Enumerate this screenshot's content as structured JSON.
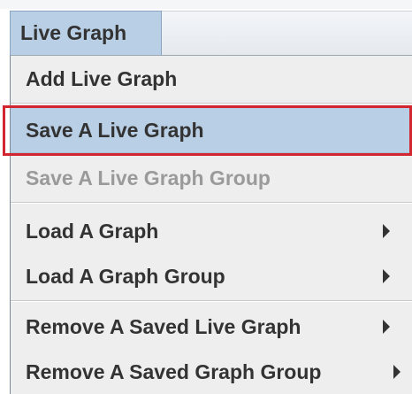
{
  "menubar": {
    "title": "Live Graph"
  },
  "menu": {
    "add_live_graph": "Add Live Graph",
    "save_live_graph": "Save A Live Graph",
    "save_live_graph_group": "Save A Live Graph Group",
    "load_graph": "Load A Graph",
    "load_graph_group": "Load A Graph Group",
    "remove_saved_live_graph": "Remove A Saved Live Graph",
    "remove_saved_graph_group": "Remove A Saved Graph Group"
  },
  "icons": {
    "submenu_arrow": "chevron-right-icon"
  },
  "colors": {
    "selection": "#b8cfe5",
    "highlight_border": "#d22630",
    "disabled_text": "#9a9a9a"
  }
}
